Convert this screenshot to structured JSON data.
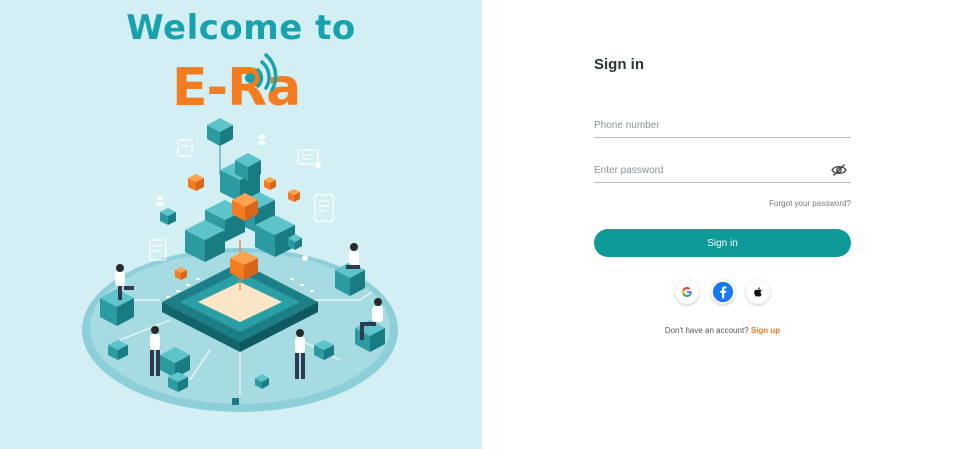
{
  "hero": {
    "welcome_text": "Welcome to",
    "brand_text": "E-Ra",
    "illustration_icon": "iot-chip-isometric-illustration"
  },
  "signin": {
    "title": "Sign in",
    "phone_placeholder": "Phone number",
    "phone_value": "",
    "password_placeholder": "Enter password",
    "password_value": "",
    "toggle_icon": "eye-off-icon",
    "forgot_label": "Forgot your password?",
    "button_label": "Sign in",
    "social": [
      {
        "name": "google-icon",
        "glyph": "G"
      },
      {
        "name": "facebook-icon",
        "glyph": "f"
      },
      {
        "name": "apple-icon",
        "glyph": ""
      }
    ],
    "no_account_text": "Don't have an account?",
    "signup_label": "Sign up"
  },
  "colors": {
    "teal": "#0f9a9a",
    "brand_teal": "#17a2ad",
    "orange": "#f37c1f",
    "hero_bg": "#d3eff3"
  }
}
